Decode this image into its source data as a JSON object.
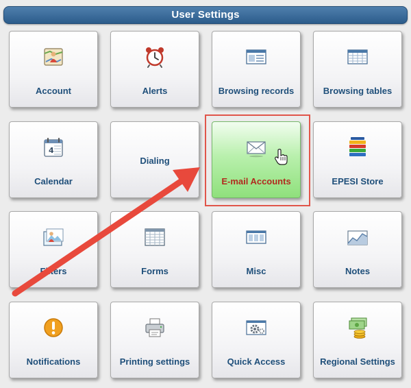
{
  "header": {
    "title": "User Settings"
  },
  "tiles": [
    {
      "label": "Account",
      "icon": "account-map-icon"
    },
    {
      "label": "Alerts",
      "icon": "alarm-clock-icon"
    },
    {
      "label": "Browsing records",
      "icon": "records-window-icon"
    },
    {
      "label": "Browsing tables",
      "icon": "table-window-icon"
    },
    {
      "label": "Calendar",
      "icon": "calendar-icon"
    },
    {
      "label": "Dialing",
      "icon": ""
    },
    {
      "label": "E-mail Accounts",
      "icon": "envelope-icon"
    },
    {
      "label": "EPESI Store",
      "icon": "stacked-books-icon"
    },
    {
      "label": "Filters",
      "icon": "filters-image-icon"
    },
    {
      "label": "Forms",
      "icon": "form-grid-icon"
    },
    {
      "label": "Misc",
      "icon": "misc-panels-icon"
    },
    {
      "label": "Notes",
      "icon": "notes-chart-icon"
    },
    {
      "label": "Notifications",
      "icon": "exclamation-icon"
    },
    {
      "label": "Printing settings",
      "icon": "printer-icon"
    },
    {
      "label": "Quick Access",
      "icon": "gear-window-icon"
    },
    {
      "label": "Regional Settings",
      "icon": "money-stack-icon"
    }
  ],
  "colors": {
    "header": "#2c5c8b",
    "label": "#1f4f7a",
    "active_tile": "#8fe07c",
    "active_label": "#b12a1e",
    "annotation": "#e0554a"
  }
}
